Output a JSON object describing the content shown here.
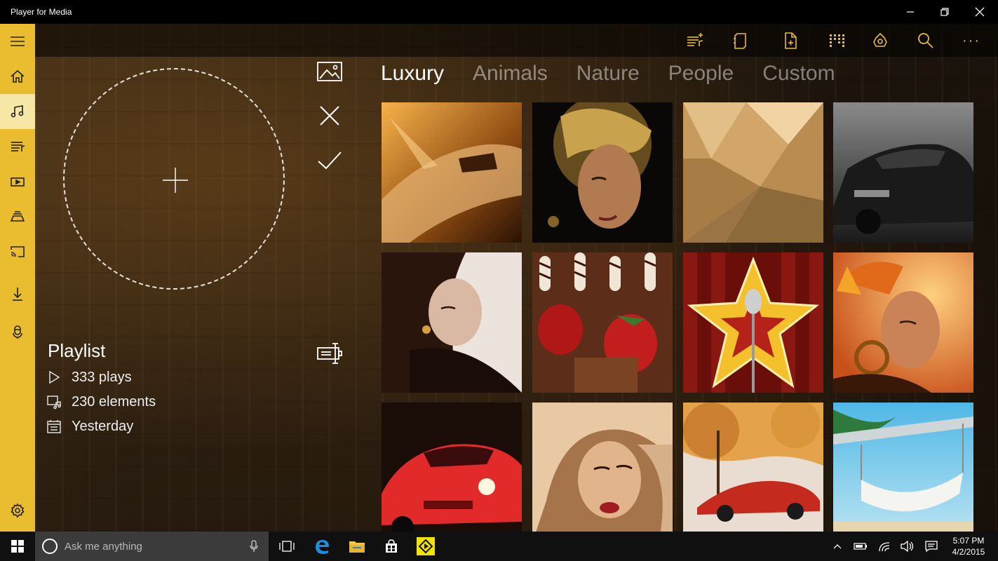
{
  "window": {
    "title": "Player for Media",
    "controls": [
      "minimize-icon",
      "restore-icon",
      "close-icon"
    ]
  },
  "sidebar": {
    "accent": "#e9bd2f",
    "items": [
      {
        "icon": "hamburger-icon"
      },
      {
        "icon": "home-icon"
      },
      {
        "icon": "music-icon",
        "active": true
      },
      {
        "icon": "playlist-icon"
      },
      {
        "icon": "video-icon"
      },
      {
        "icon": "stack-icon"
      },
      {
        "icon": "cast-icon"
      },
      {
        "icon": "download-icon"
      },
      {
        "icon": "microphone-icon"
      },
      {
        "icon": "settings-icon"
      }
    ]
  },
  "toolbar": {
    "icons": [
      "add-to-playlist-icon",
      "folder-icon",
      "new-file-icon",
      "equalizer-icon",
      "pin-icon",
      "search-icon"
    ],
    "more": "···"
  },
  "playlist": {
    "title": "Playlist",
    "plays": "333 plays",
    "elements": "230 elements",
    "date": "Yesterday"
  },
  "actions": [
    "image-icon",
    "close-icon",
    "checkmark-icon",
    "screen-icon"
  ],
  "tabs": [
    {
      "label": "Luxury",
      "active": true
    },
    {
      "label": "Animals"
    },
    {
      "label": "Nature"
    },
    {
      "label": "People"
    },
    {
      "label": "Custom"
    }
  ],
  "tiles": [
    {
      "subject": "golden airplane",
      "colors": [
        "#f7b24a",
        "#8c4a12",
        "#2a1204"
      ]
    },
    {
      "subject": "woman with gold headdress",
      "colors": [
        "#c9a24e",
        "#3a2a14",
        "#0a0806"
      ]
    },
    {
      "subject": "gold polygon texture",
      "colors": [
        "#f1d3a4",
        "#c79a5e",
        "#8d6a3a"
      ]
    },
    {
      "subject": "black sports car",
      "colors": [
        "#8a8a8a",
        "#2c2c2c",
        "#0d0d0d"
      ]
    },
    {
      "subject": "woman with earring",
      "colors": [
        "#e9e0da",
        "#5a3a2c",
        "#120b08"
      ]
    },
    {
      "subject": "strawberries and chocolate",
      "colors": [
        "#b01818",
        "#5c2e1a",
        "#f1e6d6"
      ]
    },
    {
      "subject": "golden star with microphone",
      "colors": [
        "#f4c02c",
        "#b5221a",
        "#3a0a06"
      ]
    },
    {
      "subject": "woman with autumn leaves",
      "colors": [
        "#f4a428",
        "#c8501a",
        "#3a1808"
      ]
    },
    {
      "subject": "red sports car",
      "colors": [
        "#e22a2a",
        "#6a0c0c",
        "#1a0c06"
      ]
    },
    {
      "subject": "blonde woman",
      "colors": [
        "#e8c9a4",
        "#a6744a",
        "#3a2414"
      ]
    },
    {
      "subject": "red car in autumn",
      "colors": [
        "#e4a34a",
        "#c42a1e",
        "#e8ddd0"
      ]
    },
    {
      "subject": "hammock on beach",
      "colors": [
        "#4fb7e6",
        "#eaf5f8",
        "#2e7a3c"
      ]
    }
  ],
  "taskbar": {
    "search_placeholder": "Ask me anything",
    "time": "5:07 PM",
    "date": "4/2/2015",
    "apps": [
      "task-view-icon",
      "edge-icon",
      "explorer-icon",
      "store-icon",
      "player-app-icon"
    ],
    "tray": [
      "chevron-up-icon",
      "battery-icon",
      "wifi-icon",
      "volume-icon",
      "notifications-icon"
    ]
  }
}
